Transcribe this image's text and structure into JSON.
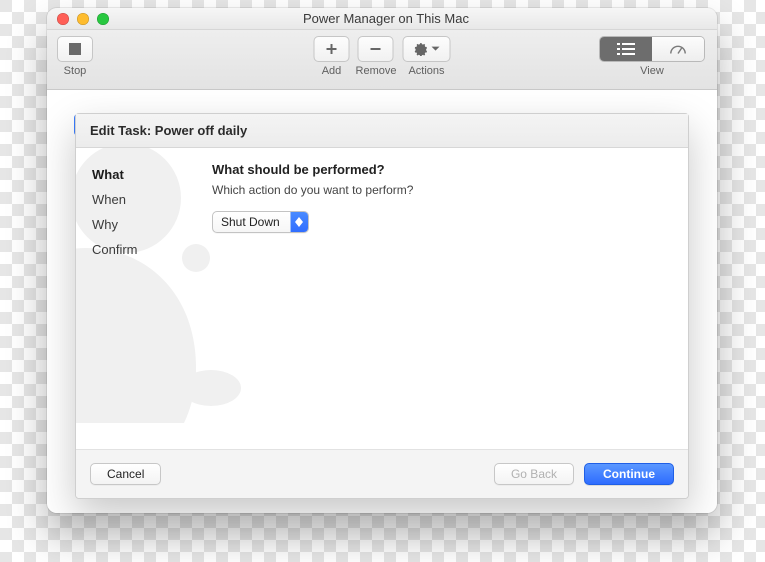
{
  "window": {
    "title": "Power Manager on This Mac"
  },
  "toolbar": {
    "stop": "Stop",
    "add": "Add",
    "remove": "Remove",
    "actions": "Actions",
    "view": "View"
  },
  "sheet": {
    "header": "Edit Task: Power off daily",
    "sidebar": {
      "items": [
        "What",
        "When",
        "Why",
        "Confirm"
      ],
      "activeIndex": 0
    },
    "question_title": "What should be performed?",
    "question_sub": "Which action do you want to perform?",
    "select_value": "Shut Down",
    "buttons": {
      "cancel": "Cancel",
      "back": "Go Back",
      "continue": "Continue"
    }
  }
}
